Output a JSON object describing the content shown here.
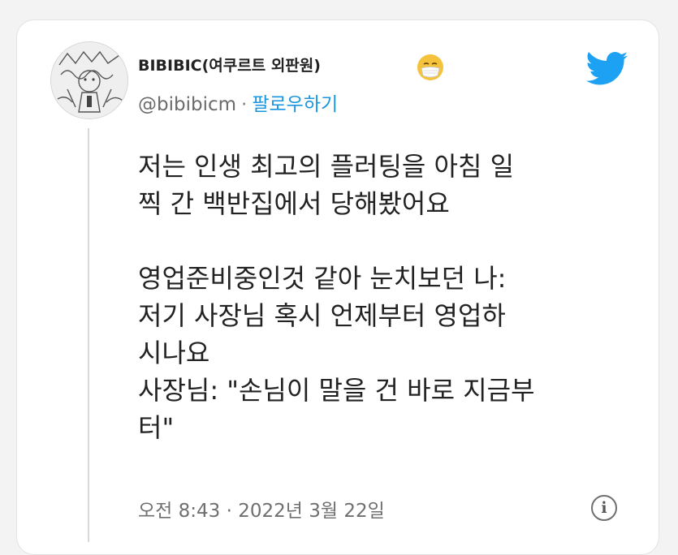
{
  "tweet": {
    "display_name": "BIBIBIC(여쿠르트 외판원)",
    "mask_emoji": "mask-face-emoji",
    "handle": "@bibibicm",
    "separator": "·",
    "follow_label": "팔로우하기",
    "text": "저는 인생 최고의 플러팅을 아침 일\n찍 간 백반집에서 당해봤어요\n\n영업준비중인것 같아 눈치보던 나:\n저기 사장님 혹시 언제부터 영업하\n시나요\n사장님: \"손님이 말을 건 바로 지금부\n터\"",
    "timestamp": "오전 8:43 · 2022년 3월 22일",
    "info_icon_label": "i"
  },
  "icons": {
    "brand": "twitter-bird-icon",
    "info": "info-icon",
    "avatar": "avatar"
  },
  "colors": {
    "brand": "#1da1f2",
    "link": "#1b95e0",
    "text": "#222222",
    "muted": "#6f6f6f"
  }
}
